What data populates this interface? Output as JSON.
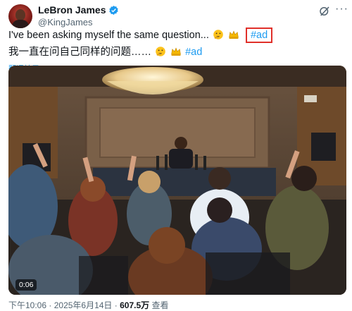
{
  "author": {
    "display_name": "LeBron James",
    "handle": "@KingJames"
  },
  "tweet": {
    "line1_text": "I've been asking myself the same question...",
    "line1_emojis": [
      "thinking-face-emoji",
      "crown-emoji"
    ],
    "line1_hashtag": "#ad",
    "line2_text": "我一直在问自己同样的问题……",
    "line2_emojis": [
      "thinking-face-emoji",
      "crown-emoji"
    ],
    "line2_hashtag": "#ad",
    "translate_label": "翻译帖子"
  },
  "video": {
    "duration": "0:06"
  },
  "meta": {
    "time": "下午10:06",
    "separator": "·",
    "date": "2025年6月14日",
    "views_count": "607.5万",
    "views_label": "查看"
  },
  "colors": {
    "link": "#1d9bf0",
    "highlight_box": "#e0302a",
    "secondary_text": "#536471"
  }
}
